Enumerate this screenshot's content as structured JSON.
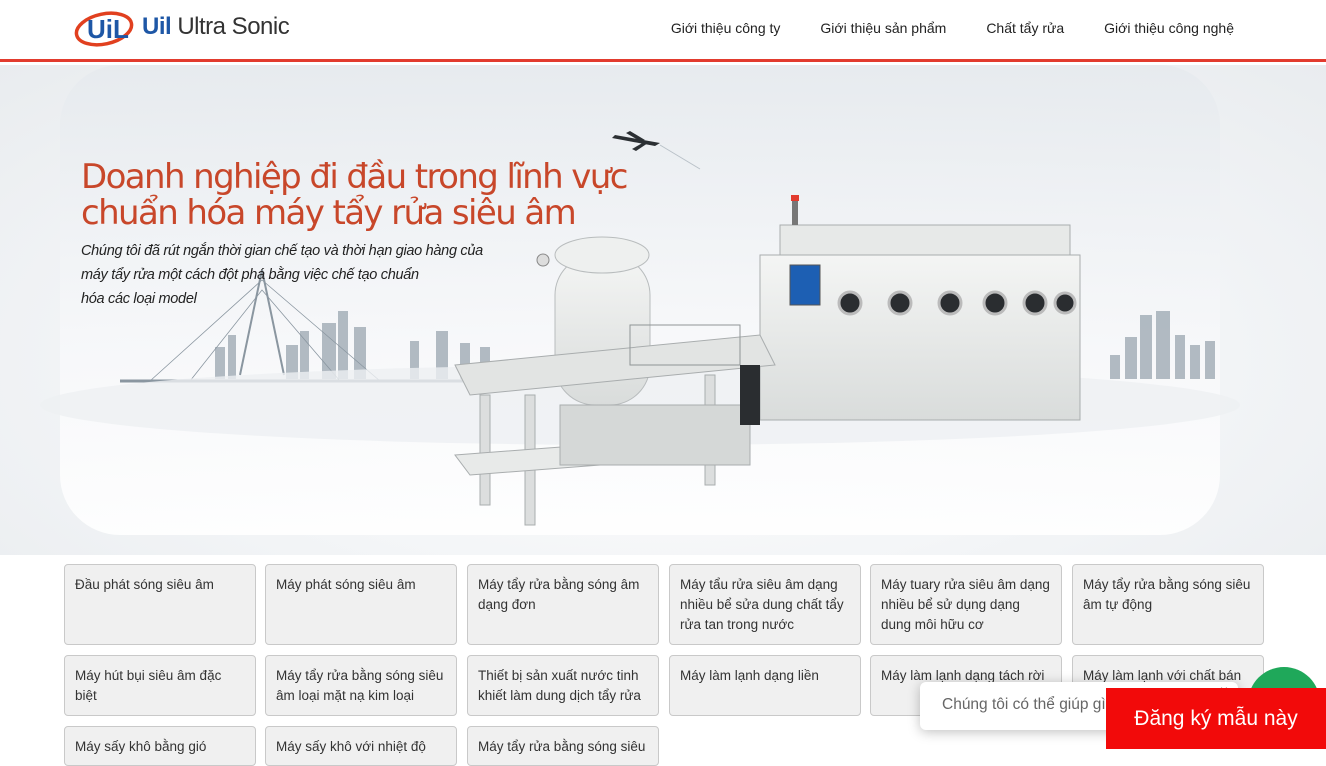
{
  "header": {
    "logo_text_uil": "Uil",
    "logo_text_rest": "Ultra Sonic",
    "nav": [
      {
        "label": "Giới thiệu công ty"
      },
      {
        "label": "Giới thiệu sản phẩm"
      },
      {
        "label": "Chất tẩy rửa"
      },
      {
        "label": "Giới thiệu công nghệ"
      }
    ]
  },
  "hero": {
    "title_line1": "Doanh nghiệp đi đầu trong lĩnh vực",
    "title_line2": "chuẩn hóa máy tẩy rửa siêu âm",
    "subtitle_line1": "Chúng tôi đã rút ngắn thời gian chế tạo và thời hạn giao hàng của",
    "subtitle_line2": "máy tẩy rửa một cách đột phá bằng việc chế tạo chuẩn",
    "subtitle_line3": "hóa các loại model"
  },
  "products": [
    {
      "label": "Đầu phát sóng siêu âm"
    },
    {
      "label": "Máy phát sóng siêu âm"
    },
    {
      "label": "Máy tẩy rửa bằng sóng âm dạng đơn"
    },
    {
      "label": "Máy tẩu rửa siêu âm dạng nhiều bể sửa dung chất tẩy rửa tan trong nước"
    },
    {
      "label": "Máy tuary rửa siêu âm dạng nhiều bể sử dụng dạng dung môi hữu cơ"
    },
    {
      "label": "Máy tẩy rửa bằng sóng siêu âm tự động"
    },
    {
      "label": "Máy hút bụi siêu âm đặc biệt"
    },
    {
      "label": "Máy tẩy rửa bằng sóng siêu âm loại mặt nạ kim loại"
    },
    {
      "label": "Thiết bị sản xuất nước tinh khiết làm dung dịch tẩy rửa"
    },
    {
      "label": "Máy làm lạnh dạng liền"
    },
    {
      "label": "Máy làm lạnh dạng tách rời"
    },
    {
      "label": "Máy làm lạnh với chất bán"
    },
    {
      "label": "Máy sấy khô bằng gió"
    },
    {
      "label": "Máy sấy khô với nhiệt độ"
    },
    {
      "label": "Máy tẩy rửa bằng sóng siêu"
    }
  ],
  "chat": {
    "placeholder": "Chúng tôi có thể giúp gì",
    "close": "×"
  },
  "signup": {
    "label": "Đăng ký mẫu này"
  },
  "colors": {
    "accent": "#e23b2e",
    "brand_blue": "#1e57a6",
    "title_red": "#c8472a",
    "signup_red": "#f20a0a",
    "chat_green": "#1fa85a"
  }
}
